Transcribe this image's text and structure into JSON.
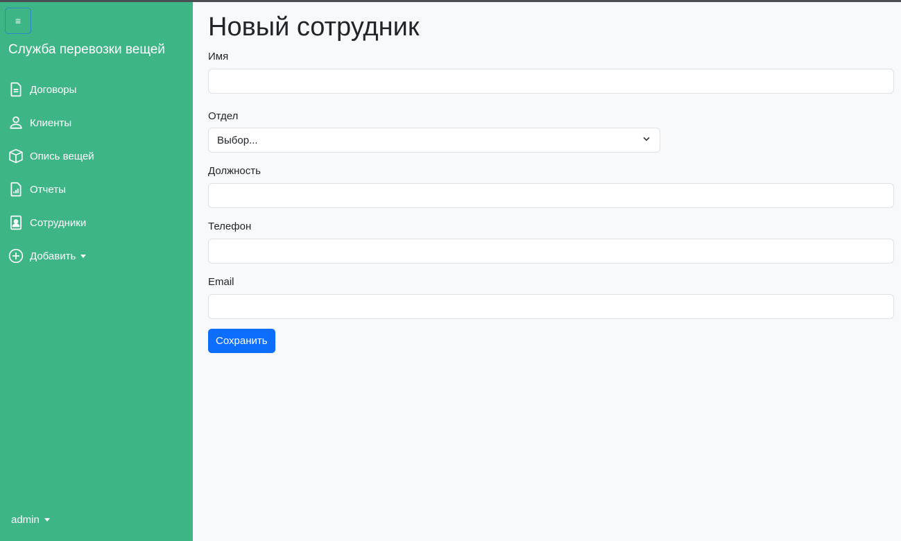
{
  "sidebar": {
    "toggle_icon": "hamburger-icon",
    "brand": "Служба перевозки вещей",
    "items": [
      {
        "label": "Договоры",
        "icon": "document-icon"
      },
      {
        "label": "Клиенты",
        "icon": "person-icon"
      },
      {
        "label": "Опись вещей",
        "icon": "box-icon"
      },
      {
        "label": "Отчеты",
        "icon": "report-icon"
      },
      {
        "label": "Сотрудники",
        "icon": "badge-icon"
      },
      {
        "label": "Добавить",
        "icon": "plus-circle-icon"
      }
    ],
    "user": "admin"
  },
  "main": {
    "title": "Новый сотрудник",
    "fields": {
      "name_label": "Имя",
      "name_value": "",
      "department_label": "Отдел",
      "department_selected": "Выбор...",
      "position_label": "Должность",
      "position_value": "",
      "phone_label": "Телефон",
      "phone_value": "",
      "email_label": "Email",
      "email_value": ""
    },
    "save_label": "Сохранить"
  },
  "colors": {
    "sidebar_bg": "#3db585",
    "page_bg": "#f8f9fa",
    "primary_button": "#0d6efd"
  }
}
